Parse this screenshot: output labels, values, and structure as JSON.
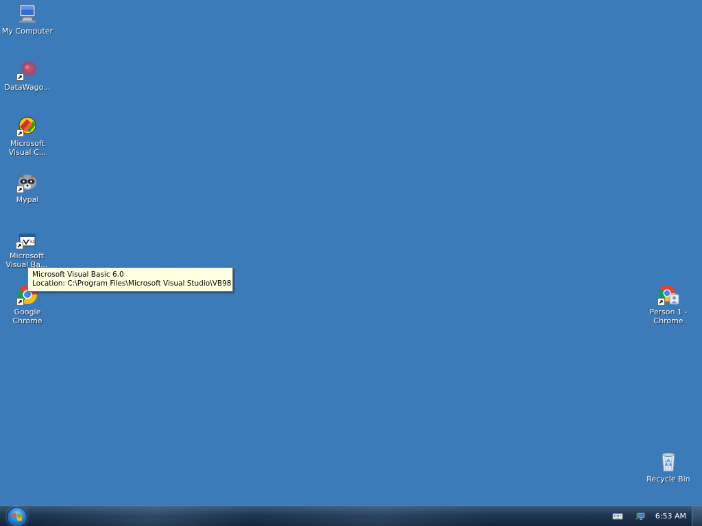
{
  "desktop": {
    "background_color": "#3c7bb9",
    "icons": [
      {
        "label": "My Computer",
        "icon": "computer-icon",
        "shortcut": false
      },
      {
        "label": "DataWago...",
        "icon": "datawagon-icon",
        "shortcut": true
      },
      {
        "label": "Microsoft Visual C...",
        "icon": "visual-cpp-icon",
        "shortcut": true
      },
      {
        "label": "Mypal",
        "icon": "mypal-raccoon-icon",
        "shortcut": true
      },
      {
        "label": "Microsoft Visual Ba...",
        "icon": "visual-basic-icon",
        "shortcut": true
      },
      {
        "label": "Google Chrome",
        "icon": "chrome-icon",
        "shortcut": true
      },
      {
        "label": "Person 1 - Chrome",
        "icon": "chrome-person-icon",
        "shortcut": true
      },
      {
        "label": "Recycle Bin",
        "icon": "recycle-bin-icon",
        "shortcut": false
      }
    ]
  },
  "tooltip": {
    "line1": "Microsoft Visual Basic 6.0",
    "line2": "Location: C:\\Program Files\\Microsoft Visual Studio\\VB98"
  },
  "taskbar": {
    "start_icon": "windows-logo-icon",
    "tray_icons": [
      "keyboard-icon",
      "network-icon"
    ],
    "clock": "6:53 AM"
  }
}
